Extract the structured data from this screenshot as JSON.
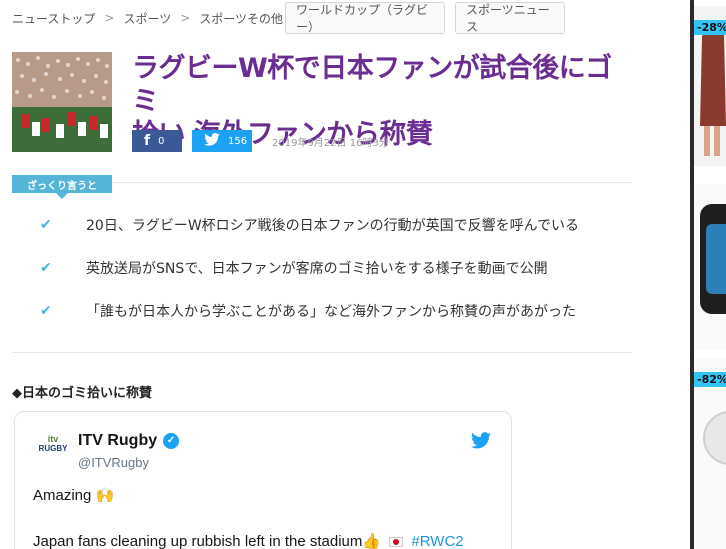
{
  "breadcrumb": {
    "items": [
      "ニューストップ",
      "スポーツ",
      "スポーツその他"
    ],
    "separator": ">"
  },
  "tags": [
    "ワールドカップ（ラグビー）",
    "スポーツニュース"
  ],
  "article": {
    "title_line1": "ラグビーW杯で日本ファンが試合後にゴミ",
    "title_line2": "拾い 海外ファンから称賛",
    "share": {
      "facebook_icon": "f",
      "facebook_count": "0",
      "twitter_count": "156"
    },
    "date": "2019年9月22日 16時3分"
  },
  "summary": {
    "label": "ざっくり言うと",
    "points": [
      "20日、ラグビーW杯ロシア戦後の日本ファンの行動が英国で反響を呼んでいる",
      "英放送局がSNSで、日本ファンが客席のゴミ拾いをする様子を動画で公開",
      "「誰もが日本人から学ぶことがある」など海外ファンから称賛の声があがった"
    ]
  },
  "section_heading": "◆日本のゴミ拾いに称賛",
  "tweet": {
    "avatar_line1": "itv",
    "avatar_line2": "RUGBY",
    "name": "ITV Rugby",
    "verified_mark": "✓",
    "handle": "@ITVRugby",
    "line1": "Amazing 🙌",
    "line2": "Japan fans cleaning up rubbish left in the stadium👍",
    "hashtag": "#RWC2"
  },
  "ads": [
    {
      "badge": "-28%"
    },
    {
      "badge": "-82%"
    }
  ],
  "colors": {
    "title": "#6a2d91",
    "accent": "#56b4d8",
    "facebook": "#3b5998",
    "twitter": "#1da1f2"
  }
}
